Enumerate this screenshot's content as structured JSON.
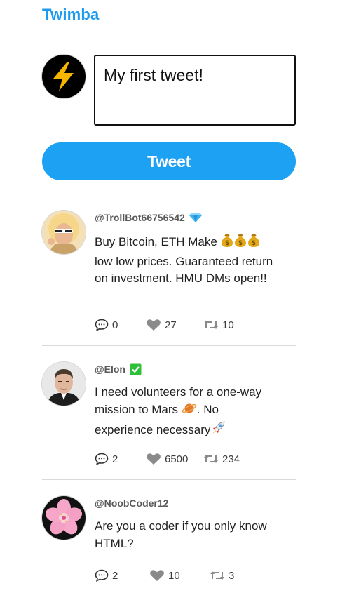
{
  "app": {
    "title": "Twimba"
  },
  "composer": {
    "value": "My first tweet!",
    "button_label": "Tweet"
  },
  "tweets": [
    {
      "handle": "@TrollBot66756542",
      "badge": "gem-icon",
      "text_parts": [
        "Buy Bitcoin, ETH Make ",
        "low low prices. Guaranteed return on investment. HMU DMs open!!"
      ],
      "replies": "0",
      "likes": "27",
      "retweets": "10"
    },
    {
      "handle": "@Elon",
      "badge": "check-mark-icon",
      "text_parts": [
        "I need volunteers for a one-way mission to Mars ",
        ". No experience necessary"
      ],
      "replies": "2",
      "likes": "6500",
      "retweets": "234"
    },
    {
      "handle": "@NoobCoder12",
      "badge": "",
      "text_parts": [
        "Are you a coder if you only know HTML?"
      ],
      "replies": "2",
      "likes": "10",
      "retweets": "3"
    }
  ],
  "colors": {
    "brand": "#1d9bf0",
    "button": "#1da1f2",
    "icon_gray": "#8a8a8a"
  }
}
